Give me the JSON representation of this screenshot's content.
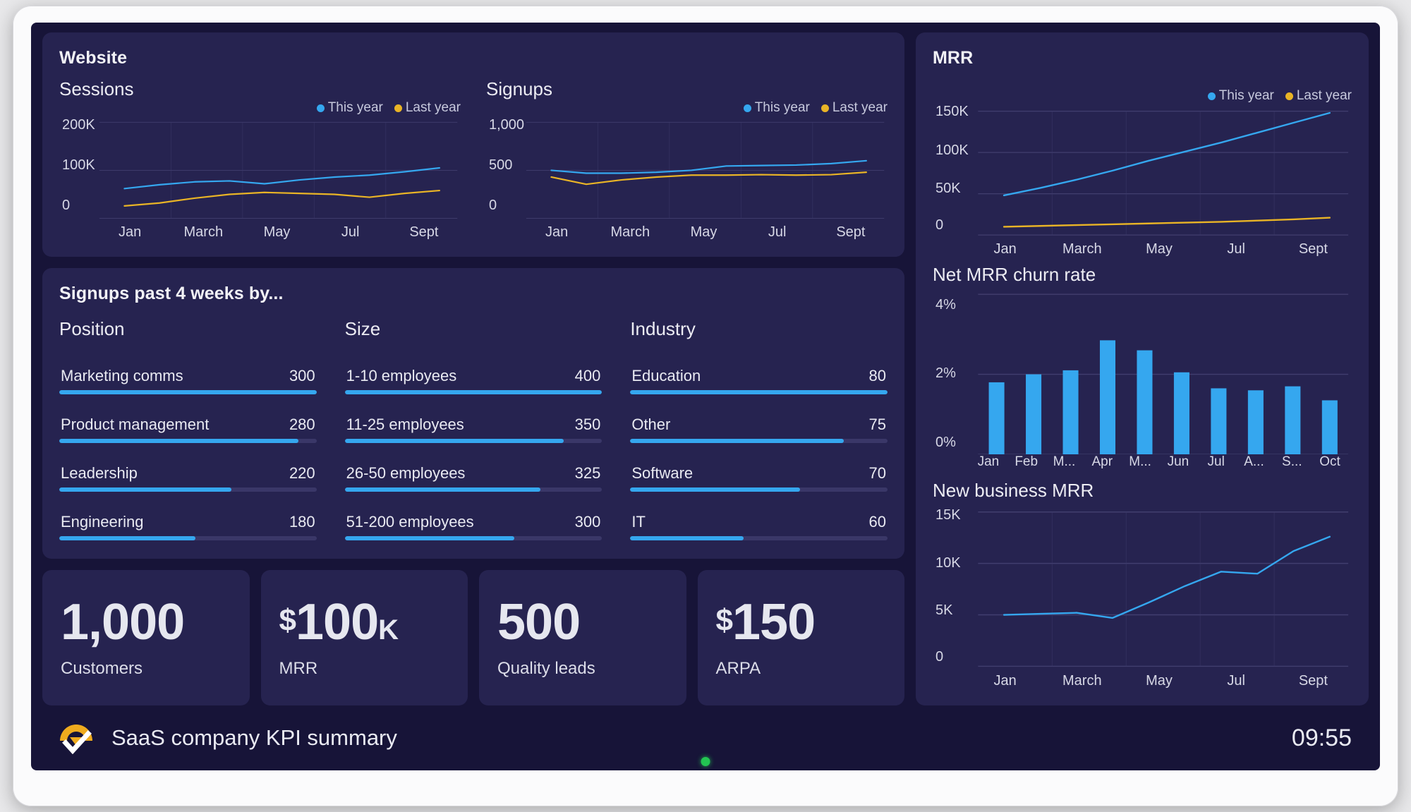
{
  "screen": {
    "footer": {
      "logo_icon": "airtasker-check-logo",
      "title": "SaaS company KPI summary",
      "clock": "09:55"
    },
    "power_led": "power-indicator"
  },
  "colors": {
    "screen_bg": "#171438",
    "card_bg": "#262350",
    "this_year": "#35a7ef",
    "last_year": "#e9b426",
    "bar": "#35a7ef",
    "track": "#3a3768",
    "text": "#e9eaf2"
  },
  "website": {
    "title": "Website",
    "legend": [
      {
        "label": "This year",
        "color": "#35a7ef"
      },
      {
        "label": "Last year",
        "color": "#e9b426"
      }
    ]
  },
  "signups_breakdown": {
    "title": "Signups past 4 weeks by...",
    "columns": [
      {
        "heading": "Position",
        "rows": [
          {
            "label": "Marketing comms",
            "value": "300",
            "pct": 100
          },
          {
            "label": "Product management",
            "value": "280",
            "pct": 93
          },
          {
            "label": "Leadership",
            "value": "220",
            "pct": 67
          },
          {
            "label": "Engineering",
            "value": "180",
            "pct": 53
          }
        ]
      },
      {
        "heading": "Size",
        "rows": [
          {
            "label": "1-10 employees",
            "value": "400",
            "pct": 100
          },
          {
            "label": "11-25 employees",
            "value": "350",
            "pct": 85
          },
          {
            "label": "26-50 employees",
            "value": "325",
            "pct": 76
          },
          {
            "label": "51-200 employees",
            "value": "300",
            "pct": 66
          }
        ]
      },
      {
        "heading": "Industry",
        "rows": [
          {
            "label": "Education",
            "value": "80",
            "pct": 100
          },
          {
            "label": "Other",
            "value": "75",
            "pct": 83
          },
          {
            "label": "Software",
            "value": "70",
            "pct": 66
          },
          {
            "label": "IT",
            "value": "60",
            "pct": 44
          }
        ]
      }
    ]
  },
  "kpis": [
    {
      "prefix": "",
      "value": "1,000",
      "suffix": "",
      "label": "Customers"
    },
    {
      "prefix": "$",
      "value": "100",
      "suffix": "K",
      "label": "MRR"
    },
    {
      "prefix": "",
      "value": "500",
      "suffix": "",
      "label": "Quality leads"
    },
    {
      "prefix": "$",
      "value": "150",
      "suffix": "",
      "label": "ARPA"
    }
  ],
  "mrr_panel": {
    "title": "MRR",
    "legend": [
      {
        "label": "This year",
        "color": "#35a7ef"
      },
      {
        "label": "Last year",
        "color": "#e9b426"
      }
    ]
  },
  "chart_data": [
    {
      "id": "sessions",
      "type": "line",
      "title": "Sessions",
      "xlabel": "",
      "ylabel": "",
      "ylim": [
        0,
        200000
      ],
      "yticks": [
        "0",
        "100K",
        "200K"
      ],
      "xticks": [
        "Jan",
        "March",
        "May",
        "Jul",
        "Sept"
      ],
      "x": [
        "Jan",
        "Feb",
        "March",
        "Apr",
        "May",
        "Jun",
        "Jul",
        "Aug",
        "Sept",
        "Oct"
      ],
      "grid": true,
      "legend_position": "top-right",
      "series": [
        {
          "name": "This year",
          "color": "#35a7ef",
          "values": [
            62000,
            70000,
            76000,
            78000,
            72000,
            80000,
            86000,
            90000,
            97000,
            105000
          ]
        },
        {
          "name": "Last year",
          "color": "#e9b426",
          "values": [
            26000,
            32000,
            42000,
            50000,
            54000,
            52000,
            50000,
            44000,
            52000,
            58000
          ]
        }
      ]
    },
    {
      "id": "signups",
      "type": "line",
      "title": "Signups",
      "xlabel": "",
      "ylabel": "",
      "ylim": [
        0,
        1000
      ],
      "yticks": [
        "0",
        "500",
        "1,000"
      ],
      "xticks": [
        "Jan",
        "March",
        "May",
        "Jul",
        "Sept"
      ],
      "x": [
        "Jan",
        "Feb",
        "March",
        "Apr",
        "May",
        "Jun",
        "Jul",
        "Aug",
        "Sept",
        "Oct"
      ],
      "grid": true,
      "legend_position": "top-right",
      "series": [
        {
          "name": "This year",
          "color": "#35a7ef",
          "values": [
            500,
            470,
            470,
            480,
            500,
            545,
            550,
            555,
            570,
            600
          ]
        },
        {
          "name": "Last year",
          "color": "#e9b426",
          "values": [
            430,
            355,
            400,
            430,
            450,
            450,
            455,
            450,
            455,
            480
          ]
        }
      ]
    },
    {
      "id": "mrr",
      "type": "line",
      "title": "MRR",
      "xlabel": "",
      "ylabel": "",
      "ylim": [
        0,
        150000
      ],
      "yticks": [
        "0",
        "50K",
        "100K",
        "150K"
      ],
      "xticks": [
        "Jan",
        "March",
        "May",
        "Jul",
        "Sept"
      ],
      "x": [
        "Jan",
        "Feb",
        "March",
        "Apr",
        "May",
        "Jun",
        "Jul",
        "Aug",
        "Sept",
        "Oct"
      ],
      "grid": true,
      "legend_position": "top-right",
      "series": [
        {
          "name": "This year",
          "color": "#35a7ef",
          "values": [
            48000,
            57000,
            67000,
            78000,
            90000,
            101000,
            112000,
            124000,
            136000,
            148000
          ]
        },
        {
          "name": "Last year",
          "color": "#e9b426",
          "values": [
            10000,
            11000,
            12000,
            13000,
            14000,
            15000,
            16000,
            17500,
            19000,
            21000
          ]
        }
      ]
    },
    {
      "id": "net-mrr-churn-rate",
      "type": "bar",
      "title": "Net MRR churn rate",
      "xlabel": "",
      "ylabel": "",
      "ylim": [
        0,
        4
      ],
      "yticks": [
        "0%",
        "2%",
        "4%"
      ],
      "categories": [
        "Jan",
        "Feb",
        "M...",
        "Apr",
        "M...",
        "Jun",
        "Jul",
        "A...",
        "S...",
        "Oct"
      ],
      "values": [
        1.8,
        2.0,
        2.1,
        2.85,
        2.6,
        2.05,
        1.65,
        1.6,
        1.7,
        1.35
      ],
      "grid": true,
      "color": "#35a7ef"
    },
    {
      "id": "new-business-mrr",
      "type": "line",
      "title": "New business MRR",
      "xlabel": "",
      "ylabel": "",
      "ylim": [
        0,
        15000
      ],
      "yticks": [
        "0",
        "5K",
        "10K",
        "15K"
      ],
      "xticks": [
        "Jan",
        "March",
        "May",
        "Jul",
        "Sept"
      ],
      "x": [
        "Jan",
        "Feb",
        "March",
        "Apr",
        "May",
        "Jun",
        "Jul",
        "Aug",
        "Sept",
        "Oct"
      ],
      "grid": true,
      "series": [
        {
          "name": "New business MRR",
          "color": "#35a7ef",
          "values": [
            5000,
            5100,
            5200,
            4700,
            6200,
            7800,
            9200,
            9000,
            11200,
            12600
          ]
        }
      ]
    }
  ]
}
